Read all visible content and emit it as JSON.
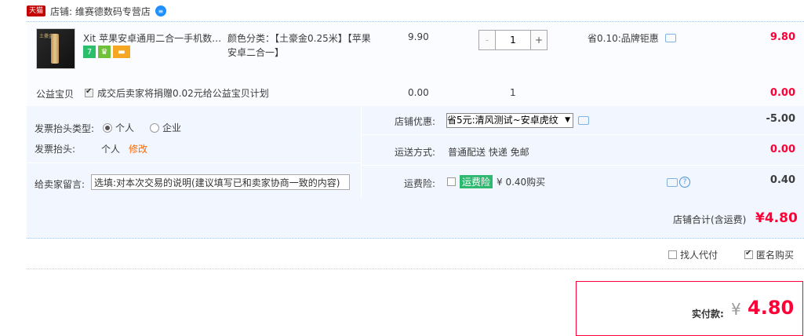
{
  "shop": {
    "tmall_badge": "天猫",
    "label": "店铺: 维赛德数码专营店"
  },
  "item": {
    "image_text": "土豪金",
    "title": "Xit 苹果安卓通用二合一手机数…",
    "badges": [
      "7",
      "",
      ""
    ],
    "sku_label": "颜色分类：",
    "sku_value": "【土豪金0.25米】【苹果安卓二合一】",
    "price": "9.90",
    "quantity": "1",
    "qty_minus": "-",
    "qty_plus": "+",
    "promo": "省0.10:品牌钜惠",
    "subtotal": "9.80"
  },
  "charity": {
    "label": "公益宝贝",
    "text": "成交后卖家将捐赠0.02元给公益宝贝计划",
    "price": "0.00",
    "qty": "1",
    "amount": "0.00"
  },
  "invoice": {
    "type_label": "发票抬头类型:",
    "option_personal": "个人",
    "option_company": "企业",
    "title_label": "发票抬头:",
    "title_value": "个人",
    "edit_link": "修改"
  },
  "memo": {
    "label": "给卖家留言:",
    "placeholder": "选填:对本次交易的说明(建议填写已和卖家协商一致的内容)"
  },
  "shop_discount": {
    "label": "店铺优惠:",
    "selected": "省5元:清风测试~安卓虎纹",
    "amount": "-5.00"
  },
  "shipping": {
    "label": "运送方式:",
    "value": "普通配送 快递 免邮",
    "amount": "0.00"
  },
  "insurance": {
    "label": "运费险:",
    "tag": "运费险",
    "value": "¥ 0.40购买",
    "amount": "0.40"
  },
  "total": {
    "label": "店铺合计(含运费)",
    "value": "¥4.80"
  },
  "options": {
    "proxy_pay": "找人代付",
    "anonymous": "匿名购买"
  },
  "payment": {
    "label": "实付款:",
    "currency": "¥",
    "value": "4.80"
  },
  "colors": {
    "accent_red": "#ff0036",
    "panel_bg": "#f2f7ff",
    "insurance_green": "#2fb86f"
  }
}
